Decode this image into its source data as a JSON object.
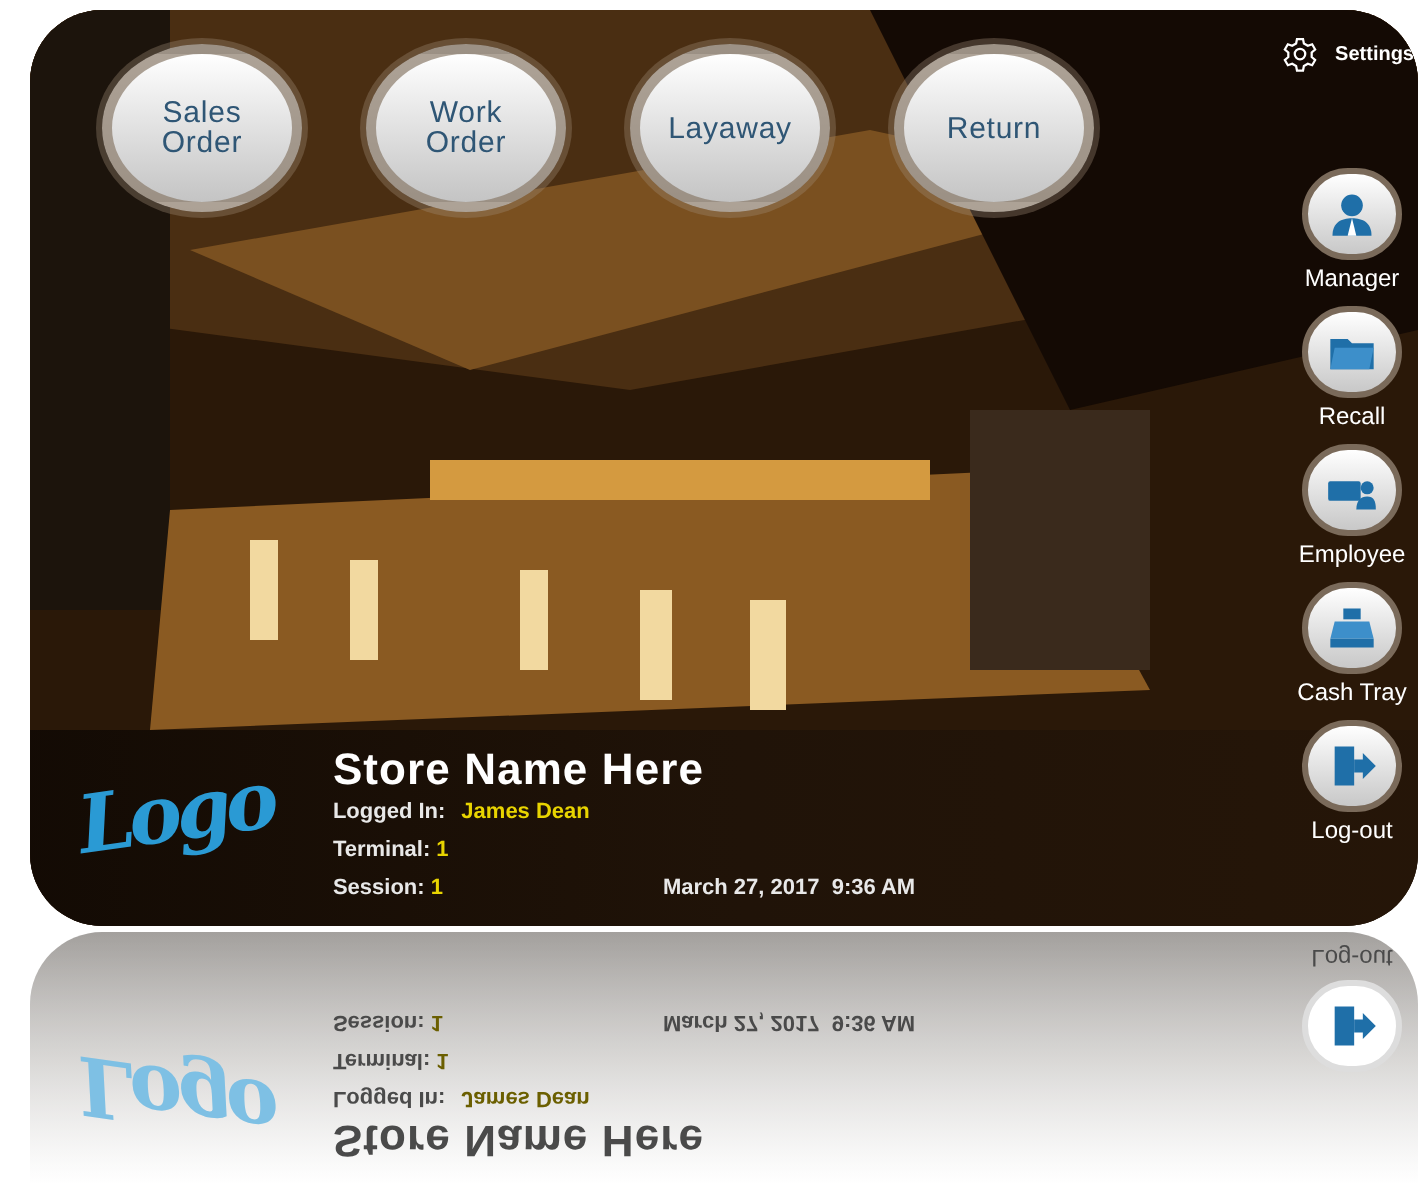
{
  "settings": {
    "label": "Settings"
  },
  "top_buttons": [
    {
      "lines": [
        "Sales",
        "Order"
      ]
    },
    {
      "lines": [
        "Work",
        "Order"
      ]
    },
    {
      "lines": [
        "Layaway"
      ]
    },
    {
      "lines": [
        "Return"
      ]
    }
  ],
  "side_actions": [
    {
      "kind": "manager",
      "label": "Manager"
    },
    {
      "kind": "recall",
      "label": "Recall"
    },
    {
      "kind": "employee",
      "label": "Employee"
    },
    {
      "kind": "cash_tray",
      "label": "Cash Tray"
    },
    {
      "kind": "log_out",
      "label": "Log-out"
    }
  ],
  "info": {
    "logo": "Logo",
    "store_name": "Store Name Here",
    "logged_in_label": "Logged In:",
    "logged_in_user": "James Dean",
    "terminal_label": "Terminal:",
    "terminal_value": "1",
    "session_label": "Session:",
    "session_value": "1",
    "datetime": "March 27, 2017  9:36 AM"
  },
  "reflection": {
    "logo": "Logo",
    "store_name": "Store Name Here",
    "logged_in_label": "Logged In:",
    "logged_in_user": "James Dean",
    "terminal_label": "Terminal:",
    "terminal_value": "1",
    "session_label": "Session:",
    "session_value": "1",
    "datetime": "March 27, 2017  9:36 AM",
    "log_out": "Log-out"
  }
}
